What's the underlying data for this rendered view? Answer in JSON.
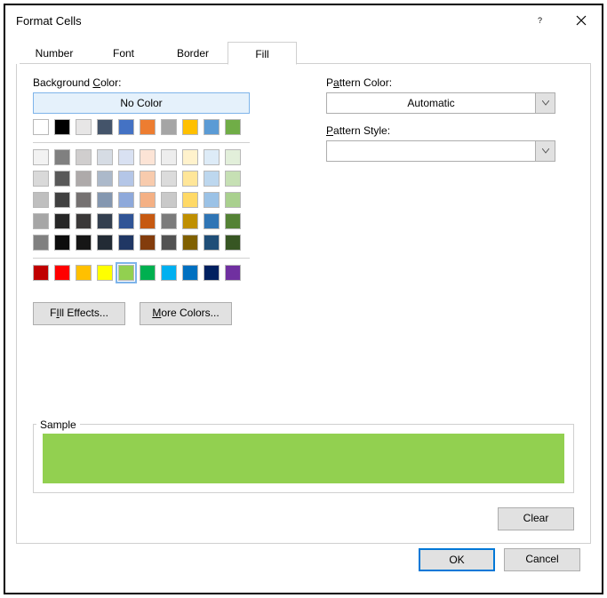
{
  "title": "Format Cells",
  "tabs": [
    "Number",
    "Font",
    "Border",
    "Fill"
  ],
  "activeTab": 3,
  "labels": {
    "backgroundColor": "Background Color:",
    "bgUnderlineChar": "C",
    "noColor": "No Color",
    "patternColor": "Pattern Color:",
    "pcUnderlineChar": "a",
    "patternStyle": "Pattern Style:",
    "psUnderlineChar": "P",
    "fillEffects": "Fill Effects...",
    "feUnderlineChar": "I",
    "moreColors": "More Colors...",
    "mcUnderlineChar": "M",
    "sample": "Sample",
    "clear": "Clear",
    "ok": "OK",
    "cancel": "Cancel"
  },
  "patternColorValue": "Automatic",
  "patternStyleValue": "",
  "sampleColor": "#92d050",
  "selectedColor": "#92d050",
  "themeRow": [
    "#ffffff",
    "#000000",
    "#e7e6e6",
    "#44546a",
    "#4472c4",
    "#ed7d31",
    "#a5a5a5",
    "#ffc000",
    "#5b9bd5",
    "#70ad47"
  ],
  "themeShades": [
    [
      "#f2f2f2",
      "#808080",
      "#d0cece",
      "#d6dce4",
      "#d9e1f2",
      "#fce4d6",
      "#ededed",
      "#fff2cc",
      "#ddebf7",
      "#e2efda"
    ],
    [
      "#d9d9d9",
      "#595959",
      "#aeaaaa",
      "#acb9ca",
      "#b4c6e7",
      "#f8cbad",
      "#dbdbdb",
      "#ffe699",
      "#bdd7ee",
      "#c6e0b4"
    ],
    [
      "#bfbfbf",
      "#404040",
      "#757171",
      "#8497b0",
      "#8ea9db",
      "#f4b084",
      "#c9c9c9",
      "#ffd966",
      "#9bc2e6",
      "#a9d08e"
    ],
    [
      "#a6a6a6",
      "#262626",
      "#3a3838",
      "#333f4f",
      "#305496",
      "#c65911",
      "#7b7b7b",
      "#bf8f00",
      "#2f75b5",
      "#548235"
    ],
    [
      "#808080",
      "#0d0d0d",
      "#161616",
      "#222b35",
      "#203764",
      "#833c0c",
      "#525252",
      "#806000",
      "#1f4e78",
      "#375623"
    ]
  ],
  "standardColors": [
    "#c00000",
    "#ff0000",
    "#ffc000",
    "#ffff00",
    "#92d050",
    "#00b050",
    "#00b0f0",
    "#0070c0",
    "#002060",
    "#7030a0"
  ]
}
